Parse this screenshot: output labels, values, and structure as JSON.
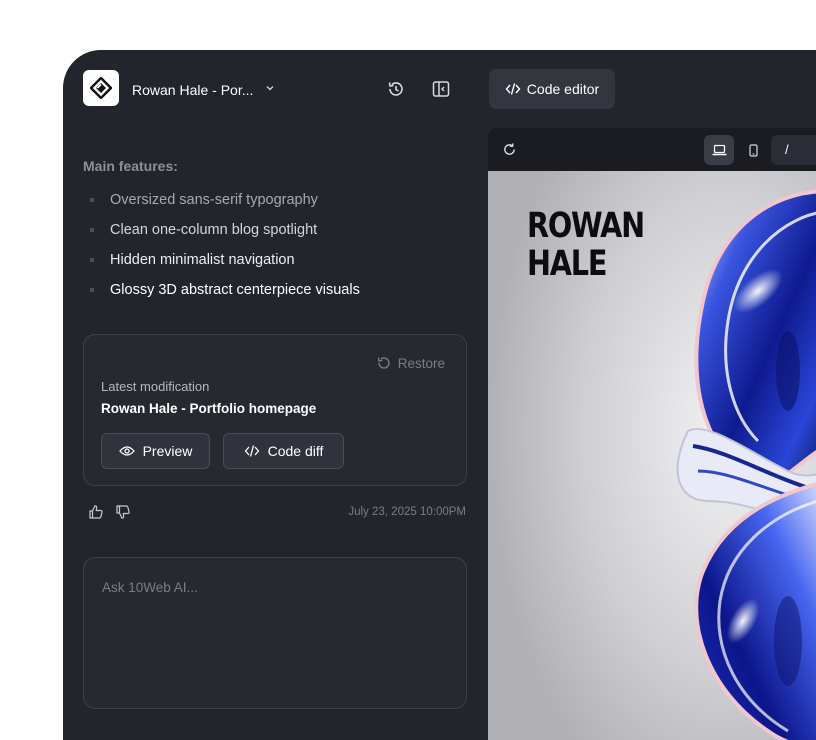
{
  "header": {
    "project_title": "Rowan Hale - Por...",
    "code_editor_label": "Code editor"
  },
  "features": {
    "title": "Main features:",
    "items": [
      {
        "label": "Oversized sans-serif typography",
        "color": "#a6a9b1"
      },
      {
        "label": "Clean one-column blog spotlight",
        "color": "#d4d6dc"
      },
      {
        "label": "Hidden minimalist navigation",
        "color": "#eceef2"
      },
      {
        "label": "Glossy 3D abstract centerpiece visuals",
        "color": "#ffffff"
      }
    ]
  },
  "modification": {
    "restore_label": "Restore",
    "label": "Latest modification",
    "title": "Rowan Hale - Portfolio homepage",
    "preview_label": "Preview",
    "code_diff_label": "Code diff"
  },
  "feedback": {
    "timestamp": "July 23, 2025 10:00PM"
  },
  "prompt": {
    "placeholder": "Ask 10Web AI...",
    "value": ""
  },
  "preview": {
    "url": "/",
    "site_title": "ROWAN\nHALE"
  },
  "colors": {
    "app_bg": "#23252d",
    "card_bg": "#272931",
    "accent_blue": "#1d2fb8"
  }
}
